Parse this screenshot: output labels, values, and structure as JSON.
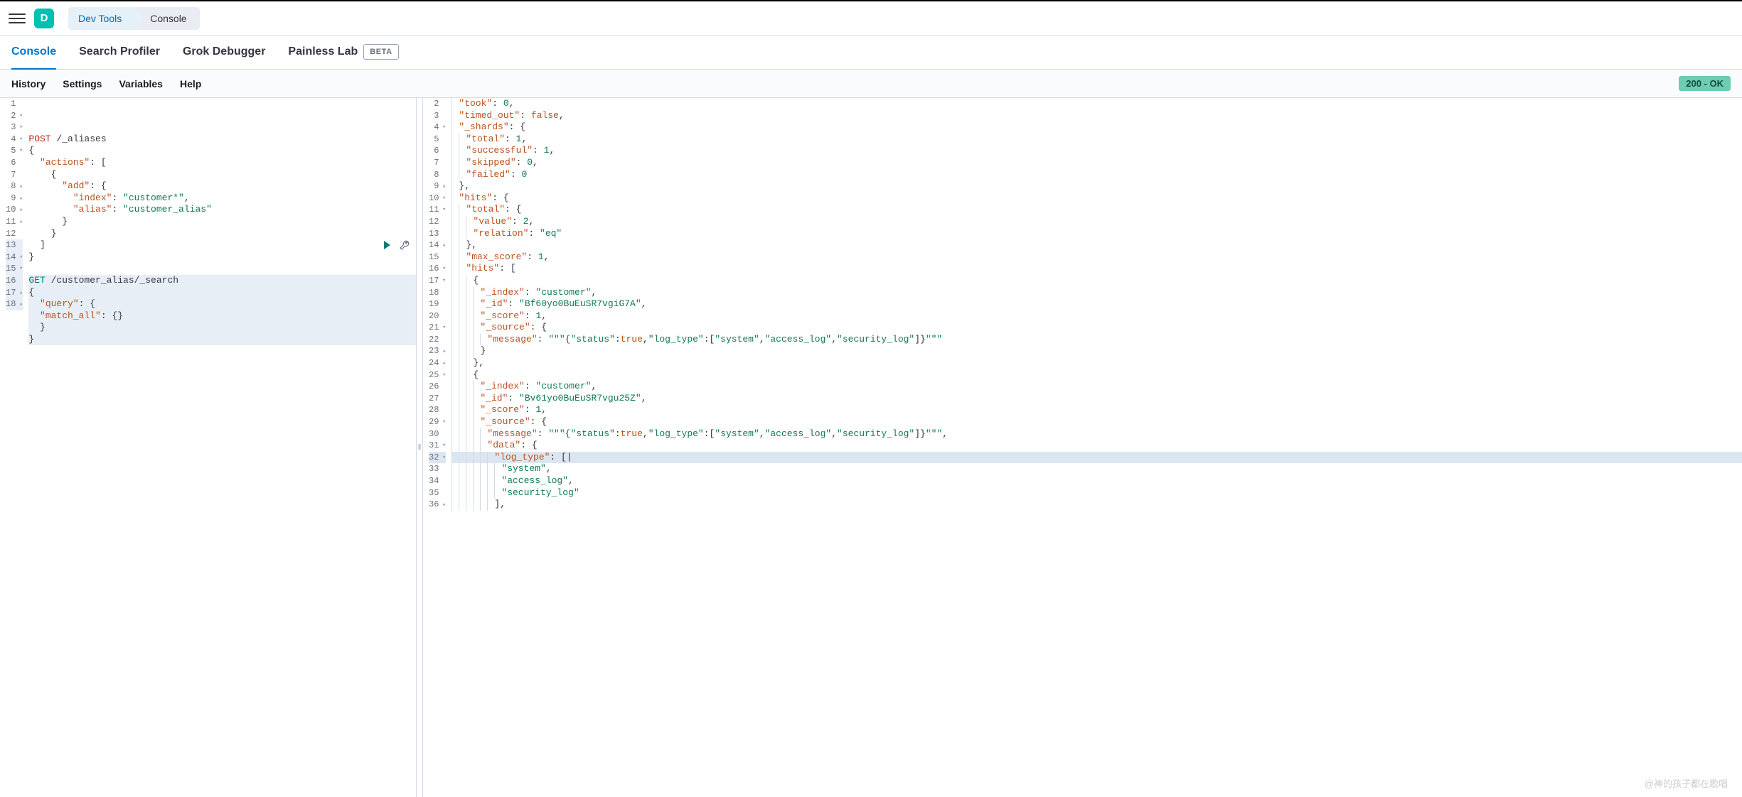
{
  "topbar": {
    "logo_letter": "D"
  },
  "breadcrumbs": [
    {
      "label": "Dev Tools",
      "active": true
    },
    {
      "label": "Console",
      "active": false
    }
  ],
  "tabs": [
    {
      "label": "Console",
      "active": true
    },
    {
      "label": "Search Profiler",
      "active": false
    },
    {
      "label": "Grok Debugger",
      "active": false
    },
    {
      "label": "Painless Lab",
      "active": false,
      "badge": "BETA"
    }
  ],
  "subbar": {
    "links": [
      "History",
      "Settings",
      "Variables",
      "Help"
    ],
    "status": "200 - OK"
  },
  "request": {
    "highlight_start": 13,
    "highlight_end": 18,
    "lines": [
      {
        "n": 1,
        "f": "",
        "seg": [
          [
            "method-post",
            "POST"
          ],
          [
            "plain",
            " /_aliases"
          ]
        ]
      },
      {
        "n": 2,
        "f": "▾",
        "seg": [
          [
            "punc",
            "{"
          ]
        ]
      },
      {
        "n": 3,
        "f": "▾",
        "seg": [
          [
            "plain",
            "  "
          ],
          [
            "key",
            "\"actions\""
          ],
          [
            "punc",
            ": ["
          ]
        ]
      },
      {
        "n": 4,
        "f": "▾",
        "seg": [
          [
            "plain",
            "    "
          ],
          [
            "punc",
            "{"
          ]
        ]
      },
      {
        "n": 5,
        "f": "▾",
        "seg": [
          [
            "plain",
            "      "
          ],
          [
            "key",
            "\"add\""
          ],
          [
            "punc",
            ": {"
          ]
        ]
      },
      {
        "n": 6,
        "f": "",
        "seg": [
          [
            "plain",
            "        "
          ],
          [
            "key",
            "\"index\""
          ],
          [
            "punc",
            ": "
          ],
          [
            "str",
            "\"customer*\""
          ],
          [
            "punc",
            ","
          ]
        ]
      },
      {
        "n": 7,
        "f": "",
        "seg": [
          [
            "plain",
            "        "
          ],
          [
            "key",
            "\"alias\""
          ],
          [
            "punc",
            ": "
          ],
          [
            "str",
            "\"customer_alias\""
          ]
        ]
      },
      {
        "n": 8,
        "f": "▴",
        "seg": [
          [
            "plain",
            "      "
          ],
          [
            "punc",
            "}"
          ]
        ]
      },
      {
        "n": 9,
        "f": "▴",
        "seg": [
          [
            "plain",
            "    "
          ],
          [
            "punc",
            "}"
          ]
        ]
      },
      {
        "n": 10,
        "f": "▴",
        "seg": [
          [
            "plain",
            "  "
          ],
          [
            "punc",
            "]"
          ]
        ]
      },
      {
        "n": 11,
        "f": "▴",
        "seg": [
          [
            "punc",
            "}"
          ]
        ]
      },
      {
        "n": 12,
        "f": "",
        "seg": []
      },
      {
        "n": 13,
        "f": "",
        "seg": [
          [
            "method-get",
            "GET"
          ],
          [
            "plain",
            " /customer_alias/_search"
          ]
        ]
      },
      {
        "n": 14,
        "f": "▾",
        "seg": [
          [
            "punc",
            "{"
          ]
        ]
      },
      {
        "n": 15,
        "f": "▾",
        "seg": [
          [
            "plain",
            "  "
          ],
          [
            "key",
            "\"query\""
          ],
          [
            "punc",
            ": {"
          ]
        ]
      },
      {
        "n": 16,
        "f": "",
        "seg": [
          [
            "plain",
            "  "
          ],
          [
            "key",
            "\"match_all\""
          ],
          [
            "punc",
            ": {}"
          ]
        ]
      },
      {
        "n": 17,
        "f": "▴",
        "seg": [
          [
            "plain",
            "  "
          ],
          [
            "punc",
            "}"
          ]
        ]
      },
      {
        "n": 18,
        "f": "▴",
        "seg": [
          [
            "punc",
            "}"
          ]
        ]
      }
    ]
  },
  "response": {
    "cursor_line": 32,
    "lines": [
      {
        "n": 2,
        "f": "",
        "i": 1,
        "seg": [
          [
            "key",
            "\"took\""
          ],
          [
            "punc",
            ": "
          ],
          [
            "num",
            "0"
          ],
          [
            "punc",
            ","
          ]
        ]
      },
      {
        "n": 3,
        "f": "",
        "i": 1,
        "seg": [
          [
            "key",
            "\"timed_out\""
          ],
          [
            "punc",
            ": "
          ],
          [
            "bool",
            "false"
          ],
          [
            "punc",
            ","
          ]
        ]
      },
      {
        "n": 4,
        "f": "▾",
        "i": 1,
        "seg": [
          [
            "key",
            "\"_shards\""
          ],
          [
            "punc",
            ": {"
          ]
        ]
      },
      {
        "n": 5,
        "f": "",
        "i": 2,
        "seg": [
          [
            "key",
            "\"total\""
          ],
          [
            "punc",
            ": "
          ],
          [
            "num",
            "1"
          ],
          [
            "punc",
            ","
          ]
        ]
      },
      {
        "n": 6,
        "f": "",
        "i": 2,
        "seg": [
          [
            "key",
            "\"successful\""
          ],
          [
            "punc",
            ": "
          ],
          [
            "num",
            "1"
          ],
          [
            "punc",
            ","
          ]
        ]
      },
      {
        "n": 7,
        "f": "",
        "i": 2,
        "seg": [
          [
            "key",
            "\"skipped\""
          ],
          [
            "punc",
            ": "
          ],
          [
            "num",
            "0"
          ],
          [
            "punc",
            ","
          ]
        ]
      },
      {
        "n": 8,
        "f": "",
        "i": 2,
        "seg": [
          [
            "key",
            "\"failed\""
          ],
          [
            "punc",
            ": "
          ],
          [
            "num",
            "0"
          ]
        ]
      },
      {
        "n": 9,
        "f": "▴",
        "i": 1,
        "seg": [
          [
            "punc",
            "},"
          ]
        ]
      },
      {
        "n": 10,
        "f": "▾",
        "i": 1,
        "seg": [
          [
            "key",
            "\"hits\""
          ],
          [
            "punc",
            ": {"
          ]
        ]
      },
      {
        "n": 11,
        "f": "▾",
        "i": 2,
        "seg": [
          [
            "key",
            "\"total\""
          ],
          [
            "punc",
            ": {"
          ]
        ]
      },
      {
        "n": 12,
        "f": "",
        "i": 3,
        "seg": [
          [
            "key",
            "\"value\""
          ],
          [
            "punc",
            ": "
          ],
          [
            "num",
            "2"
          ],
          [
            "punc",
            ","
          ]
        ]
      },
      {
        "n": 13,
        "f": "",
        "i": 3,
        "seg": [
          [
            "key",
            "\"relation\""
          ],
          [
            "punc",
            ": "
          ],
          [
            "str",
            "\"eq\""
          ]
        ]
      },
      {
        "n": 14,
        "f": "▴",
        "i": 2,
        "seg": [
          [
            "punc",
            "},"
          ]
        ]
      },
      {
        "n": 15,
        "f": "",
        "i": 2,
        "seg": [
          [
            "key",
            "\"max_score\""
          ],
          [
            "punc",
            ": "
          ],
          [
            "num",
            "1"
          ],
          [
            "punc",
            ","
          ]
        ]
      },
      {
        "n": 16,
        "f": "▾",
        "i": 2,
        "seg": [
          [
            "key",
            "\"hits\""
          ],
          [
            "punc",
            ": ["
          ]
        ]
      },
      {
        "n": 17,
        "f": "▾",
        "i": 3,
        "seg": [
          [
            "punc",
            "{"
          ]
        ]
      },
      {
        "n": 18,
        "f": "",
        "i": 4,
        "seg": [
          [
            "key",
            "\"_index\""
          ],
          [
            "punc",
            ": "
          ],
          [
            "str",
            "\"customer\""
          ],
          [
            "punc",
            ","
          ]
        ]
      },
      {
        "n": 19,
        "f": "",
        "i": 4,
        "seg": [
          [
            "key",
            "\"_id\""
          ],
          [
            "punc",
            ": "
          ],
          [
            "str",
            "\"Bf60yo0BuEuSR7vgiG7A\""
          ],
          [
            "punc",
            ","
          ]
        ]
      },
      {
        "n": 20,
        "f": "",
        "i": 4,
        "seg": [
          [
            "key",
            "\"_score\""
          ],
          [
            "punc",
            ": "
          ],
          [
            "num",
            "1"
          ],
          [
            "punc",
            ","
          ]
        ]
      },
      {
        "n": 21,
        "f": "▾",
        "i": 4,
        "seg": [
          [
            "key",
            "\"_source\""
          ],
          [
            "punc",
            ": {"
          ]
        ]
      },
      {
        "n": 22,
        "f": "",
        "i": 5,
        "seg": [
          [
            "key",
            "\"message\""
          ],
          [
            "punc",
            ": "
          ],
          [
            "str",
            "\"\"\"{"
          ],
          [
            "msgkey",
            "\"status\""
          ],
          [
            "punc",
            ":"
          ],
          [
            "bool",
            "true"
          ],
          [
            "punc",
            ","
          ],
          [
            "msgkey",
            "\"log_type\""
          ],
          [
            "punc",
            ":["
          ],
          [
            "str",
            "\"system\""
          ],
          [
            "punc",
            ","
          ],
          [
            "str",
            "\"access_log\""
          ],
          [
            "punc",
            ","
          ],
          [
            "str",
            "\"security_log\""
          ],
          [
            "punc",
            "]}"
          ],
          [
            "str",
            "\"\"\""
          ]
        ]
      },
      {
        "n": 23,
        "f": "▴",
        "i": 4,
        "seg": [
          [
            "punc",
            "}"
          ]
        ]
      },
      {
        "n": 24,
        "f": "▴",
        "i": 3,
        "seg": [
          [
            "punc",
            "},"
          ]
        ]
      },
      {
        "n": 25,
        "f": "▾",
        "i": 3,
        "seg": [
          [
            "punc",
            "{"
          ]
        ]
      },
      {
        "n": 26,
        "f": "",
        "i": 4,
        "seg": [
          [
            "key",
            "\"_index\""
          ],
          [
            "punc",
            ": "
          ],
          [
            "str",
            "\"customer\""
          ],
          [
            "punc",
            ","
          ]
        ]
      },
      {
        "n": 27,
        "f": "",
        "i": 4,
        "seg": [
          [
            "key",
            "\"_id\""
          ],
          [
            "punc",
            ": "
          ],
          [
            "str",
            "\"Bv61yo0BuEuSR7vgu25Z\""
          ],
          [
            "punc",
            ","
          ]
        ]
      },
      {
        "n": 28,
        "f": "",
        "i": 4,
        "seg": [
          [
            "key",
            "\"_score\""
          ],
          [
            "punc",
            ": "
          ],
          [
            "num",
            "1"
          ],
          [
            "punc",
            ","
          ]
        ]
      },
      {
        "n": 29,
        "f": "▾",
        "i": 4,
        "seg": [
          [
            "key",
            "\"_source\""
          ],
          [
            "punc",
            ": {"
          ]
        ]
      },
      {
        "n": 30,
        "f": "",
        "i": 5,
        "seg": [
          [
            "key",
            "\"message\""
          ],
          [
            "punc",
            ": "
          ],
          [
            "str",
            "\"\"\"{"
          ],
          [
            "msgkey",
            "\"status\""
          ],
          [
            "punc",
            ":"
          ],
          [
            "bool",
            "true"
          ],
          [
            "punc",
            ","
          ],
          [
            "msgkey",
            "\"log_type\""
          ],
          [
            "punc",
            ":["
          ],
          [
            "str",
            "\"system\""
          ],
          [
            "punc",
            ","
          ],
          [
            "str",
            "\"access_log\""
          ],
          [
            "punc",
            ","
          ],
          [
            "str",
            "\"security_log\""
          ],
          [
            "punc",
            "]}"
          ],
          [
            "str",
            "\"\"\""
          ],
          [
            "punc",
            ","
          ]
        ]
      },
      {
        "n": 31,
        "f": "▾",
        "i": 5,
        "seg": [
          [
            "key",
            "\"data\""
          ],
          [
            "punc",
            ": {"
          ]
        ]
      },
      {
        "n": 32,
        "f": "▾",
        "i": 6,
        "seg": [
          [
            "key",
            "\"log_type\""
          ],
          [
            "punc",
            ": [|"
          ]
        ]
      },
      {
        "n": 33,
        "f": "",
        "i": 7,
        "seg": [
          [
            "str",
            "\"system\""
          ],
          [
            "punc",
            ","
          ]
        ]
      },
      {
        "n": 34,
        "f": "",
        "i": 7,
        "seg": [
          [
            "str",
            "\"access_log\""
          ],
          [
            "punc",
            ","
          ]
        ]
      },
      {
        "n": 35,
        "f": "",
        "i": 7,
        "seg": [
          [
            "str",
            "\"security_log\""
          ]
        ]
      },
      {
        "n": 36,
        "f": "▴",
        "i": 6,
        "seg": [
          [
            "punc",
            "],"
          ]
        ]
      }
    ]
  },
  "watermark": "@神的孩子都在歌唱"
}
